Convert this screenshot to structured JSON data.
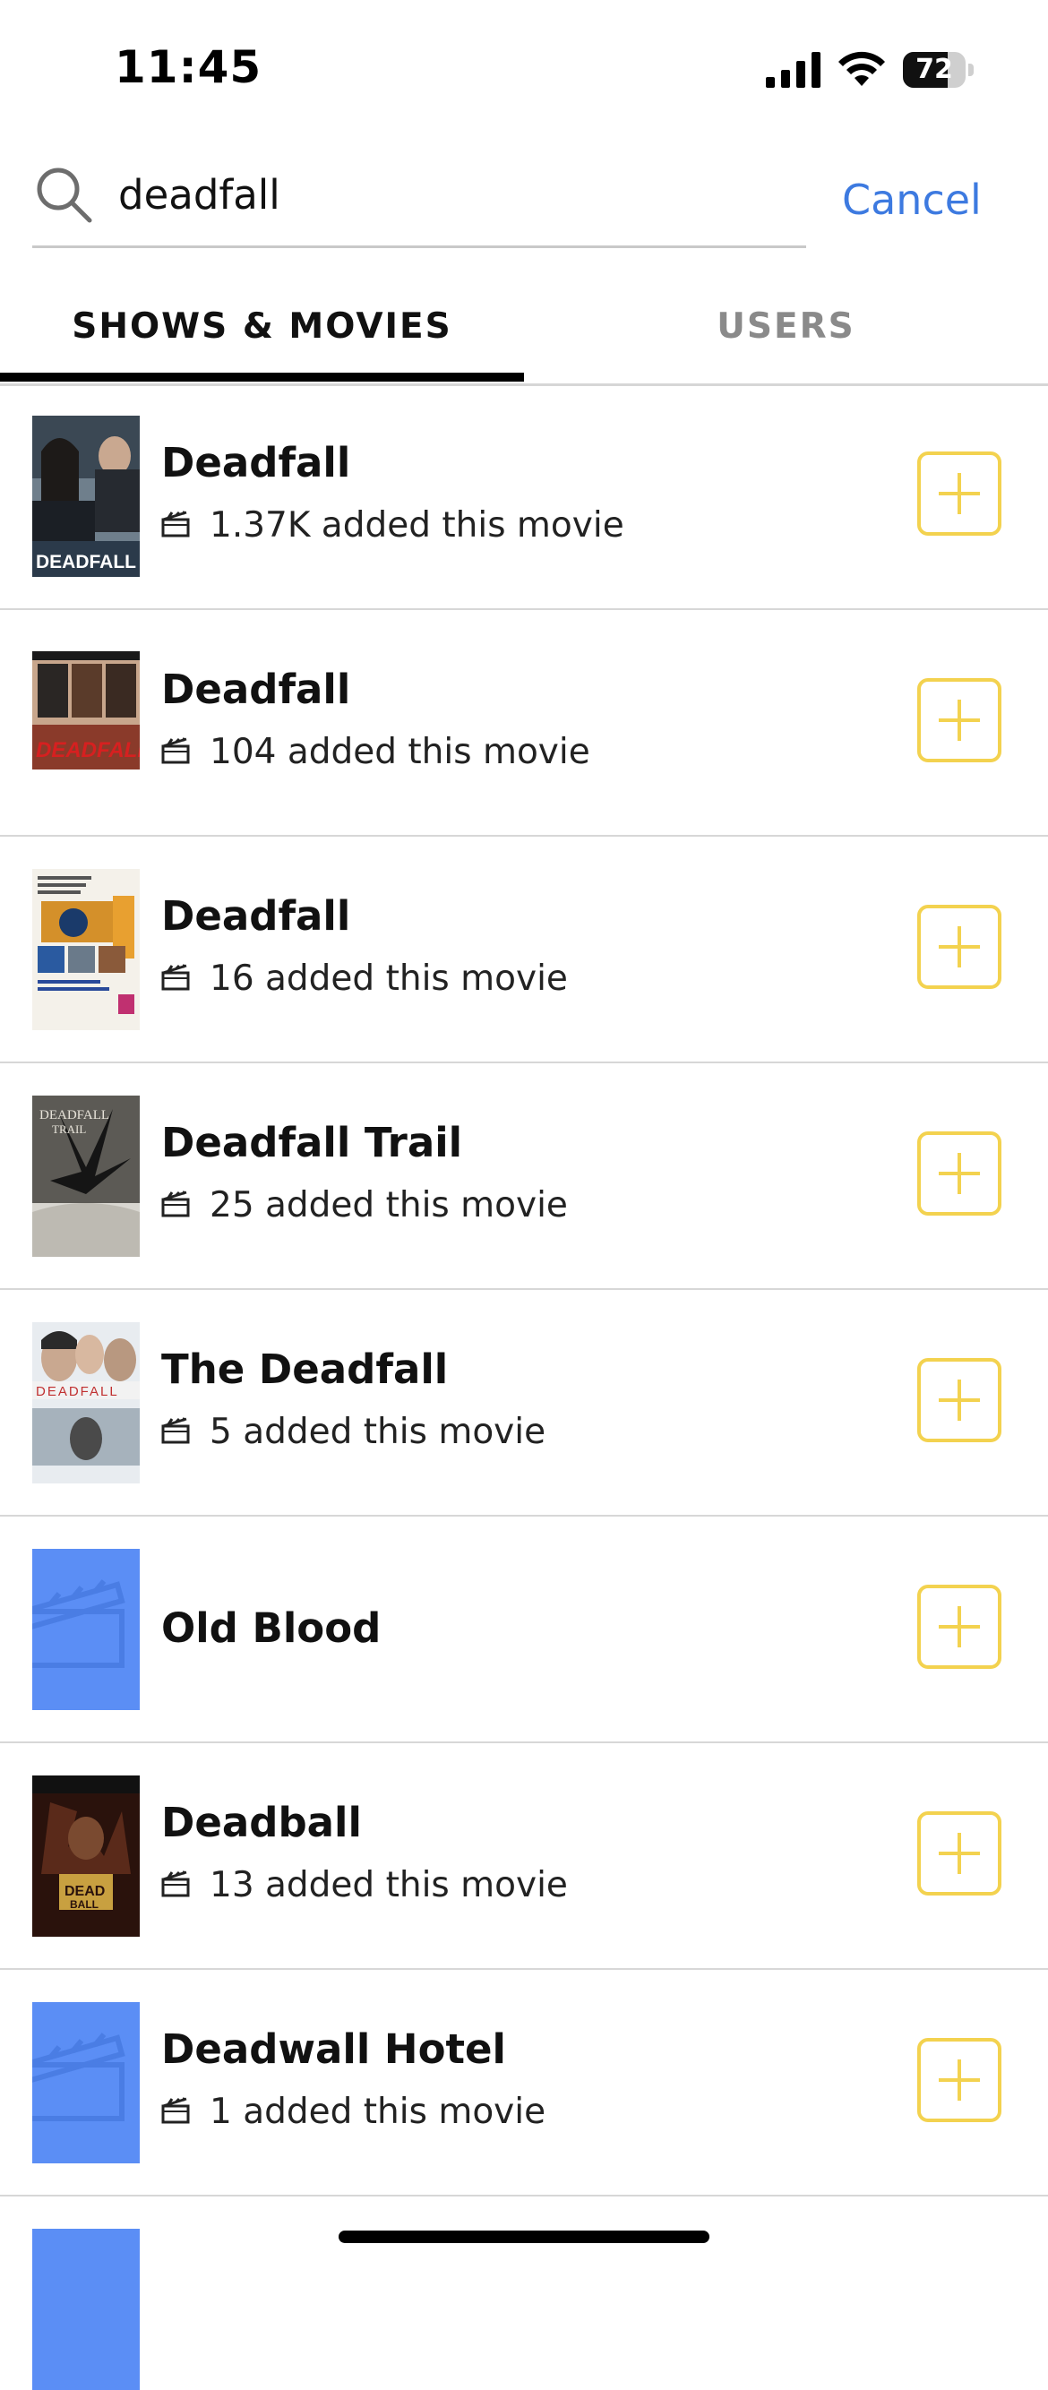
{
  "status_bar": {
    "time": "11:45",
    "battery": "72",
    "battery_fraction": 0.72
  },
  "search": {
    "value": "deadfall",
    "placeholder": "Search",
    "cancel_label": "Cancel"
  },
  "tabs": [
    {
      "label": "SHOWS & MOVIES",
      "active": true
    },
    {
      "label": "USERS",
      "active": false
    }
  ],
  "results": [
    {
      "title": "Deadfall",
      "added": "1.37K added this movie",
      "poster": "poster-deadfall-2012"
    },
    {
      "title": "Deadfall",
      "added": "104 added this movie",
      "poster": "poster-deadfall-1993"
    },
    {
      "title": "Deadfall",
      "added": "16 added this movie",
      "poster": "poster-deadfall-1968"
    },
    {
      "title": "Deadfall Trail",
      "added": "25 added this movie",
      "poster": "poster-deadfall-trail"
    },
    {
      "title": "The Deadfall",
      "added": "5 added this movie",
      "poster": "poster-the-deadfall"
    },
    {
      "title": "Old Blood",
      "added": "",
      "poster": "placeholder-clapperboard"
    },
    {
      "title": "Deadball",
      "added": "13 added this movie",
      "poster": "poster-deadball"
    },
    {
      "title": "Deadwall Hotel",
      "added": "1 added this movie",
      "poster": "placeholder-clapperboard"
    }
  ],
  "colors": {
    "accent_blue": "#3d7ae0",
    "add_button_yellow": "#f3d24f",
    "placeholder_blue": "#5b8ef5"
  }
}
